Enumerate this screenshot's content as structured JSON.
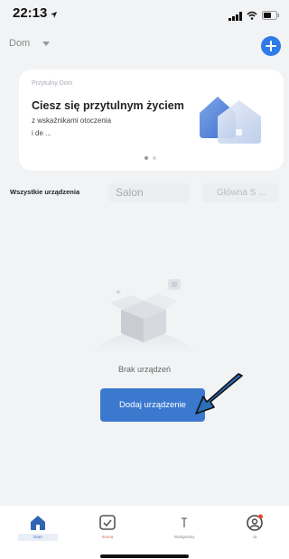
{
  "status_bar": {
    "time": "22:13"
  },
  "header": {
    "home_name": "Dom"
  },
  "banner": {
    "kicker": "Przytulny Dom",
    "title": "Ciesz się przytulnym życiem",
    "line1": "z wskaźnikami otoczenia",
    "line2": "i de ..."
  },
  "tabs": {
    "all": "Wszystkie urządzenia",
    "salon": "Salon",
    "main": "Główna S ..."
  },
  "empty_state": {
    "message": "Brak urządzeń",
    "add_button": "Dodaj urządzenie"
  },
  "bottom_nav": [
    {
      "label": "Dom",
      "icon": "home-icon"
    },
    {
      "label": "Scena",
      "icon": "checkbox-icon"
    },
    {
      "label": "Inteligentny",
      "icon": "smart-icon"
    },
    {
      "label": "Ja",
      "icon": "profile-icon"
    }
  ],
  "colors": {
    "accent": "#2f7be8",
    "button": "#3b79cf",
    "arrow": "#2a6fb8"
  }
}
